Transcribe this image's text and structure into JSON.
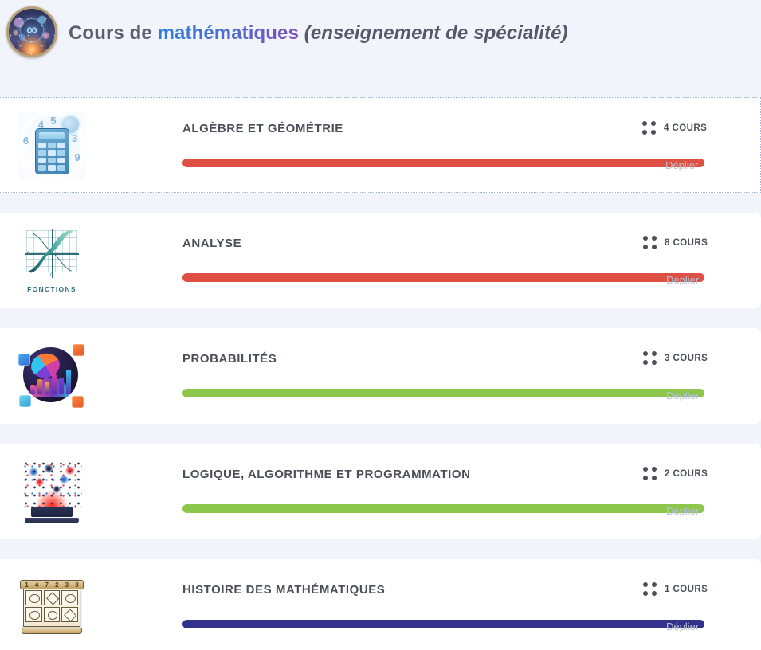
{
  "header": {
    "icon": "cosmic-infinity-icon",
    "prefix": "Cours de ",
    "accent": "mathématiques",
    "suffix": " (enseignement de spécialité)"
  },
  "colors": {
    "page_background": "#f1f4fa",
    "card_background": "#ffffff",
    "bar_red": "#dd5043",
    "bar_green": "#8cc64a",
    "bar_navy": "#32318c",
    "title_text": "#4b4f58",
    "muted_link": "#b7c2d2",
    "accent_gradient_start": "#2f7fd6",
    "accent_gradient_end": "#7c4fbb",
    "selected_border": "#9fb7d6"
  },
  "common": {
    "expand_label": "Déplier",
    "count_icon": "grid-dots-icon"
  },
  "sections": [
    {
      "title": "ALGÈBRE ET GÉOMÉTRIE",
      "icon": "calculator-night-icon",
      "count_label": "4 COURS",
      "count": 4,
      "expand_label": "Déplier",
      "bar_color": "#dd5043",
      "bar_percent": 100,
      "selected": true
    },
    {
      "title": "ANALYSE",
      "icon": "function-curve-icon",
      "icon_caption": "FONCTIONS",
      "count_label": "8 COURS",
      "count": 8,
      "expand_label": "Déplier",
      "bar_color": "#dd5043",
      "bar_percent": 100,
      "selected": false
    },
    {
      "title": "PROBABILITÉS",
      "icon": "pie-chart-dice-icon",
      "count_label": "3 COURS",
      "count": 3,
      "expand_label": "Déplier",
      "bar_color": "#8cc64a",
      "bar_percent": 100,
      "selected": false
    },
    {
      "title": "LOGIQUE, ALGORITHME ET PROGRAMMATION",
      "icon": "laptop-burst-icon",
      "count_label": "2 COURS",
      "count": 2,
      "expand_label": "Déplier",
      "bar_color": "#8cc64a",
      "bar_percent": 100,
      "selected": false
    },
    {
      "title": "HISTOIRE DES MATHÉMATIQUES",
      "icon": "ancient-scroll-icon",
      "count_label": "1 COURS",
      "count": 1,
      "expand_label": "Déplier",
      "bar_color": "#32318c",
      "bar_percent": 100,
      "selected": false
    }
  ]
}
